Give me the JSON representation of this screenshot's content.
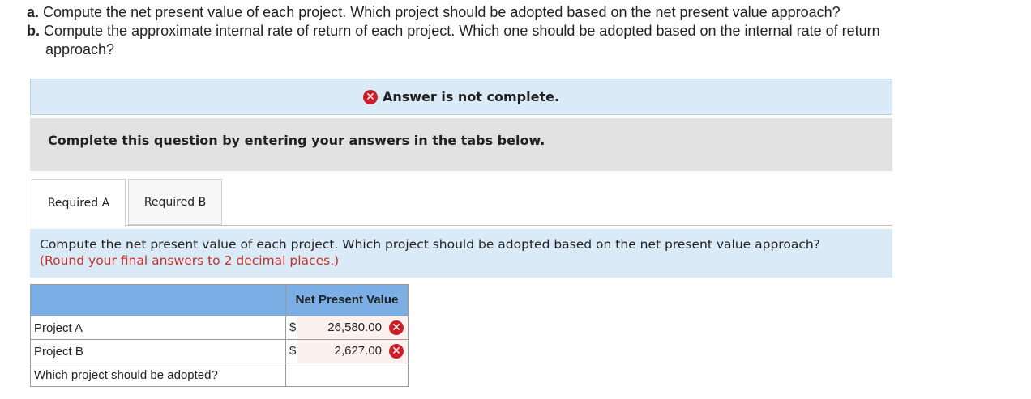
{
  "questions": {
    "a_marker": "a.",
    "a_text": " Compute the net present value of each project. Which project should be adopted based on the net present value approach?",
    "b_marker": "b.",
    "b_text": " Compute the approximate internal rate of return of each project. Which one should be adopted based on the internal rate of return",
    "b_text_cont": "approach?"
  },
  "banner": {
    "icon": "x-circle-icon",
    "text": "Answer is not complete."
  },
  "instructions": "Complete this question by entering your answers in the tabs below.",
  "tabs": [
    {
      "label": "Required A"
    },
    {
      "label": "Required B"
    }
  ],
  "prompt": {
    "text": "Compute the net present value of each project. Which project should be adopted based on the net present value approach?",
    "note": "(Round your final answers to 2 decimal places.)"
  },
  "table": {
    "header": "Net Present Value",
    "rows": [
      {
        "label": "Project A",
        "currency": "$",
        "value": "26,580.00",
        "status": "incorrect"
      },
      {
        "label": "Project B",
        "currency": "$",
        "value": "2,627.00",
        "status": "incorrect"
      },
      {
        "label": "Which project should be adopted?",
        "value": ""
      }
    ]
  },
  "colors": {
    "error_red": "#c8202a",
    "banner_bg": "#dbeaf7",
    "table_header": "#7aaee5",
    "note_red": "#c7302a"
  }
}
